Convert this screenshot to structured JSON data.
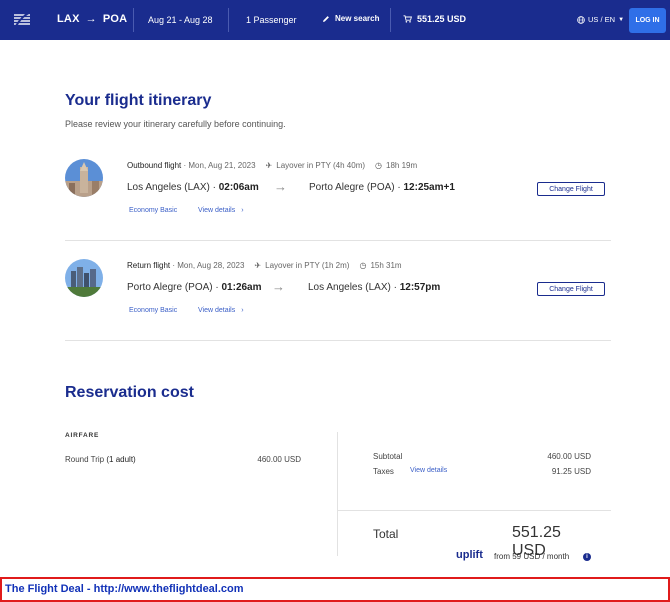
{
  "header": {
    "logo_icon": "airline-logo-icon",
    "origin": "LAX",
    "destination": "POA",
    "dates": "Aug 21 - Aug 28",
    "passengers": "1 Passenger",
    "new_search_label": "New search",
    "cart_total": "551.25 USD",
    "locale": "US / EN",
    "login_label": "LOG IN",
    "bg_color": "#1a2c8e",
    "login_color": "#2f6fe8"
  },
  "itinerary": {
    "title": "Your flight itinerary",
    "subtitle": "Please review your itinerary carefully before continuing.",
    "flights": [
      {
        "type_label": "Outbound flight",
        "date": "Mon, Aug 21, 2023",
        "layover": "Layover in PTY (4h 40m)",
        "duration": "18h 19m",
        "from_city": "Los Angeles (LAX)",
        "from_time": "02:06am",
        "to_city": "Porto Alegre (POA)",
        "to_time": "12:25am+1",
        "fare_class": "Economy Basic",
        "details_label": "View details",
        "change_label": "Change Flight"
      },
      {
        "type_label": "Return flight",
        "date": "Mon, Aug 28, 2023",
        "layover": "Layover in PTY (1h 2m)",
        "duration": "15h 31m",
        "from_city": "Porto Alegre (POA)",
        "from_time": "01:26am",
        "to_city": "Los Angeles (LAX)",
        "to_time": "12:57pm",
        "fare_class": "Economy Basic",
        "details_label": "View details",
        "change_label": "Change Flight"
      }
    ]
  },
  "reservation": {
    "title": "Reservation cost",
    "airfare_heading": "AIRFARE",
    "trip_type": "Round Trip",
    "travelers": "(1 adult)",
    "airfare_value": "460.00 USD",
    "subtotal_label": "Subtotal",
    "subtotal_value": "460.00 USD",
    "taxes_label": "Taxes",
    "taxes_link": "View details",
    "taxes_value": "91.25 USD",
    "total_label": "Total",
    "total_value": "551.25 USD",
    "uplift_brand": "uplift",
    "uplift_text": "from 59 USD  / month"
  },
  "banner": {
    "text": "The Flight Deal - http://www.theflightdeal.com",
    "border_color": "#e01b1b"
  }
}
